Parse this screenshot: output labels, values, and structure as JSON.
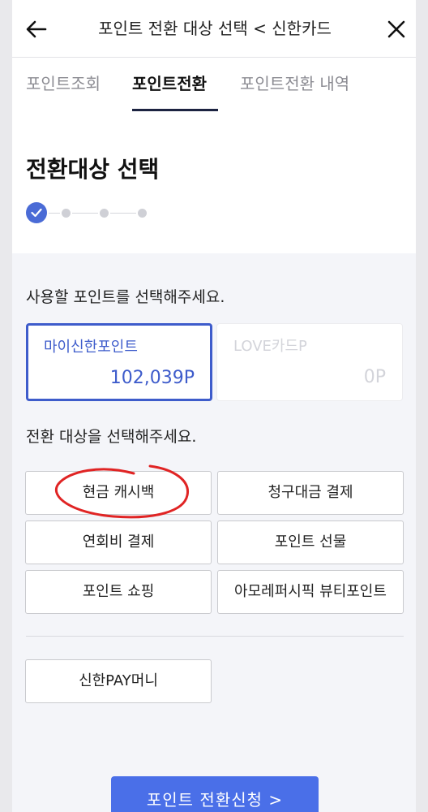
{
  "header": {
    "title": "포인트 전환 대상 선택 < 신한카드",
    "back_icon": "arrow-left-icon",
    "close_icon": "close-icon"
  },
  "tabs": [
    {
      "label": "포인트조회",
      "active": false
    },
    {
      "label": "포인트전환",
      "active": true
    },
    {
      "label": "포인트전환 내역",
      "active": false
    }
  ],
  "section_title": "전환대상 선택",
  "stepper": {
    "total_steps": 4,
    "current_step": 1
  },
  "point_prompt": "사용할 포인트를 선택해주세요.",
  "point_cards": [
    {
      "name": "마이신한포인트",
      "value": "102,039P",
      "selected": true
    },
    {
      "name": "LOVE카드P",
      "value": "0P",
      "selected": false
    }
  ],
  "target_prompt": "전환 대상을 선택해주세요.",
  "targets": [
    {
      "label": "현금 캐시백"
    },
    {
      "label": "청구대금 결제"
    },
    {
      "label": "연회비 결제"
    },
    {
      "label": "포인트 선물"
    },
    {
      "label": "포인트 쇼핑"
    },
    {
      "label": "아모레퍼시픽 뷰티포인트"
    },
    {
      "label": "신한PAY머니"
    }
  ],
  "cta_label": "포인트 전환신청 >",
  "colors": {
    "accent": "#3e5ccb",
    "cta": "#4a6fe8",
    "annotation": "#e02424",
    "content_bg": "#f4f5f9"
  }
}
